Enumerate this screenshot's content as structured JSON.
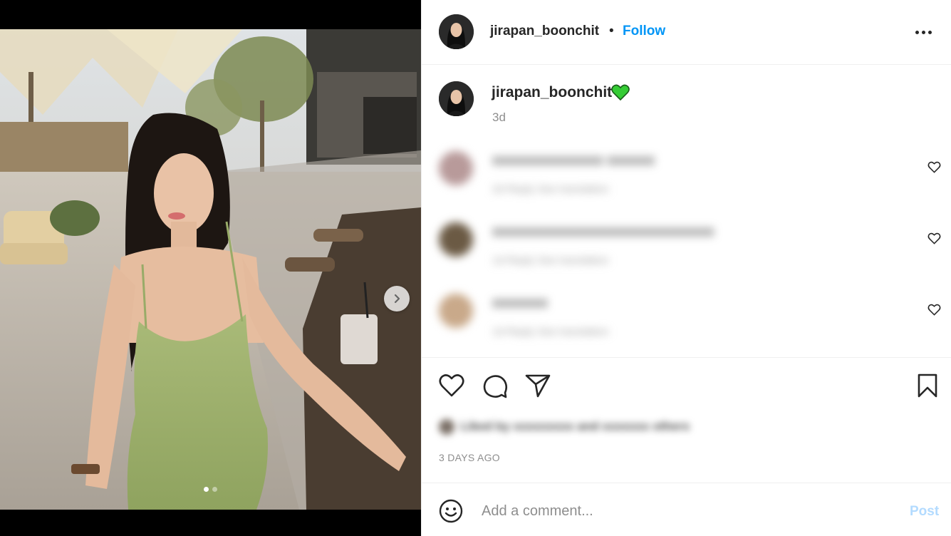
{
  "post": {
    "username": "jirapan_boonchit",
    "separator": "•",
    "follow_label": "Follow",
    "more_icon": "more-horizontal-icon",
    "caption_emoji": "green-heart-emoji",
    "caption_time": "3d",
    "timestamp": "3 DAYS AGO",
    "carousel": {
      "slides": 2,
      "active_slide": 1
    }
  },
  "comments": [
    {
      "text": "xxxxxxxxxxxxxx xxxxxx",
      "meta": "2d  Reply  See translation",
      "avatar_color": "#b89a9a"
    },
    {
      "text": "xxxxxxxxxxxxxxxxxxxxxxxxxxxx",
      "meta": "1d  Reply  See translation",
      "avatar_color": "#6b5a44"
    },
    {
      "text": "xxxxxxx",
      "meta": "1d  Reply  See translation",
      "avatar_color": "#c9a98a"
    }
  ],
  "likes_text": "Liked by xxxxxxxxx and xxxxxxx others",
  "comment_box": {
    "placeholder": "Add a comment...",
    "post_label": "Post"
  },
  "colors": {
    "accent": "#0095f6",
    "post_disabled": "#b3dbff",
    "muted": "#8e8e8e",
    "emoji_green": "#2ecc2e"
  }
}
